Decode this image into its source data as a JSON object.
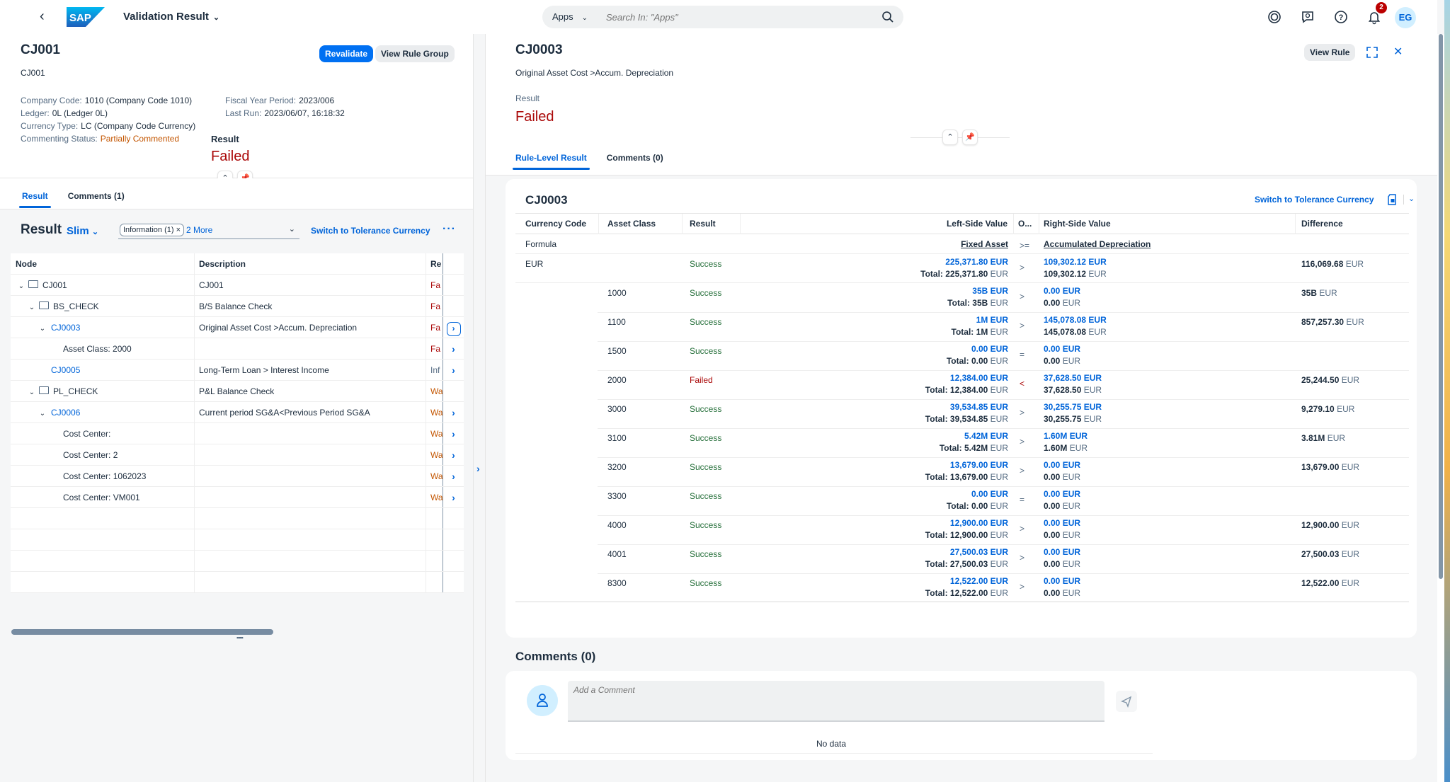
{
  "shell": {
    "app_title": "Validation Result",
    "search_scope": "Apps",
    "search_placeholder": "Search In: \"Apps\"",
    "notification_count": "2",
    "avatar_initials": "EG",
    "icons": [
      "back-icon",
      "sap-logo",
      "joule-icon",
      "feedback-icon",
      "help-icon",
      "notifications-icon"
    ]
  },
  "left": {
    "title": "CJ001",
    "subtitle": "CJ001",
    "buttons": {
      "revalidate": "Revalidate",
      "view_rule_group": "View Rule Group"
    },
    "attributes": {
      "company_code": {
        "label": "Company Code:",
        "value": "1010 (Company Code 1010)"
      },
      "ledger": {
        "label": "Ledger:",
        "value": "0L (Ledger 0L)"
      },
      "currency_type": {
        "label": "Currency Type:",
        "value": "LC (Company Code Currency)"
      },
      "commenting_status": {
        "label": "Commenting Status:",
        "value": "Partially Commented"
      },
      "fiscal_year_period": {
        "label": "Fiscal Year Period:",
        "value": "2023/006"
      },
      "last_run": {
        "label": "Last Run:",
        "value": "2023/06/07, 16:18:32"
      }
    },
    "result_label": "Result",
    "result_value": "Failed",
    "tabs": [
      {
        "label": "Result"
      },
      {
        "label": "Comments (1)"
      }
    ],
    "toolbar": {
      "title": "Result",
      "variant": "Slim",
      "filter_token": "Information (1)",
      "filter_more": "2 More",
      "switch_tolerance": "Switch to Tolerance Currency"
    },
    "table": {
      "columns": [
        "Node",
        "Description",
        "Re"
      ],
      "rows": [
        {
          "node": "CJ001",
          "description": "CJ001",
          "result": "Fa",
          "status": "failed"
        },
        {
          "node": "BS_CHECK",
          "description": "B/S Balance Check",
          "result": "Fa",
          "status": "failed"
        },
        {
          "node": "CJ0003",
          "description": "Original Asset Cost >Accum. Depreciation",
          "result": "Fa",
          "status": "failed"
        },
        {
          "node": "Asset Class: 2000",
          "description": "",
          "result": "Fa",
          "status": "failed"
        },
        {
          "node": "CJ0005",
          "description": "Long-Term Loan > Interest Income",
          "result": "Inf",
          "status": "info"
        },
        {
          "node": "PL_CHECK",
          "description": "P&L Balance Check",
          "result": "Wa",
          "status": "warning"
        },
        {
          "node": "CJ0006",
          "description": "Current period SG&A<Previous Period SG&A",
          "result": "Wa",
          "status": "warning"
        },
        {
          "node": "Cost Center:",
          "description": "",
          "result": "Wa",
          "status": "warning"
        },
        {
          "node": "Cost Center: 2",
          "description": "",
          "result": "Wa",
          "status": "warning"
        },
        {
          "node": "Cost Center: 1062023",
          "description": "",
          "result": "Wa",
          "status": "warning"
        },
        {
          "node": "Cost Center: VM001",
          "description": "",
          "result": "Wa",
          "status": "warning"
        }
      ]
    }
  },
  "right": {
    "title": "CJ0003",
    "subtitle": "Original Asset Cost >Accum. Depreciation",
    "result_label": "Result",
    "result_value": "Failed",
    "view_rule": "View Rule",
    "tabs": [
      {
        "label": "Rule-Level Result"
      },
      {
        "label": "Comments (0)"
      }
    ],
    "card": {
      "title": "CJ0003",
      "switch_tolerance": "Switch to Tolerance Currency",
      "columns": [
        "Currency Code",
        "Asset Class",
        "Result",
        "Left-Side Value",
        "O...",
        "Right-Side Value",
        "Difference"
      ],
      "formula": {
        "label": "Formula",
        "left": "Fixed Asset",
        "operator": ">=",
        "right": "Accumulated Depreciation"
      },
      "rows": [
        {
          "currency": "EUR",
          "asset_class": "",
          "result": "Success",
          "left": "225,371.80",
          "left_total": "225,371.80",
          "op": ">",
          "right": "109,302.12",
          "right_total": "109,302.12",
          "diff": "116,069.68"
        },
        {
          "currency": "",
          "asset_class": "1000",
          "result": "Success",
          "left": "35B",
          "left_total": "35B",
          "op": ">",
          "right": "0.00",
          "right_total": "0.00",
          "diff": "35B"
        },
        {
          "currency": "",
          "asset_class": "1100",
          "result": "Success",
          "left": "1M",
          "left_total": "1M",
          "op": ">",
          "right": "145,078.08",
          "right_total": "145,078.08",
          "diff": "857,257.30"
        },
        {
          "currency": "",
          "asset_class": "1500",
          "result": "Success",
          "left": "0.00",
          "left_total": "0.00",
          "op": "=",
          "right": "0.00",
          "right_total": "0.00",
          "diff": ""
        },
        {
          "currency": "",
          "asset_class": "2000",
          "result": "Failed",
          "left": "12,384.00",
          "left_total": "12,384.00",
          "op": "<",
          "right": "37,628.50",
          "right_total": "37,628.50",
          "diff": "25,244.50"
        },
        {
          "currency": "",
          "asset_class": "3000",
          "result": "Success",
          "left": "39,534.85",
          "left_total": "39,534.85",
          "op": ">",
          "right": "30,255.75",
          "right_total": "30,255.75",
          "diff": "9,279.10"
        },
        {
          "currency": "",
          "asset_class": "3100",
          "result": "Success",
          "left": "5.42M",
          "left_total": "5.42M",
          "op": ">",
          "right": "1.60M",
          "right_total": "1.60M",
          "diff": "3.81M"
        },
        {
          "currency": "",
          "asset_class": "3200",
          "result": "Success",
          "left": "13,679.00",
          "left_total": "13,679.00",
          "op": ">",
          "right": "0.00",
          "right_total": "0.00",
          "diff": "13,679.00"
        },
        {
          "currency": "",
          "asset_class": "3300",
          "result": "Success",
          "left": "0.00",
          "left_total": "0.00",
          "op": "=",
          "right": "0.00",
          "right_total": "0.00",
          "diff": ""
        },
        {
          "currency": "",
          "asset_class": "4000",
          "result": "Success",
          "left": "12,900.00",
          "left_total": "12,900.00",
          "op": ">",
          "right": "0.00",
          "right_total": "0.00",
          "diff": "12,900.00"
        },
        {
          "currency": "",
          "asset_class": "4001",
          "result": "Success",
          "left": "27,500.03",
          "left_total": "27,500.03",
          "op": ">",
          "right": "0.00",
          "right_total": "0.00",
          "diff": "27,500.03"
        },
        {
          "currency": "",
          "asset_class": "8300",
          "result": "Success",
          "left": "12,522.00",
          "left_total": "12,522.00",
          "op": ">",
          "right": "0.00",
          "right_total": "0.00",
          "diff": "12,522.00"
        }
      ],
      "unit": "EUR",
      "total_prefix": "Total:"
    },
    "comments": {
      "title": "Comments (0)",
      "placeholder": "Add a Comment",
      "no_data": "No data"
    }
  },
  "colors": {
    "brand": "#0070f2",
    "link": "#0064d9",
    "error": "#aa0808",
    "warning": "#c35500",
    "success": "#256f3a"
  }
}
